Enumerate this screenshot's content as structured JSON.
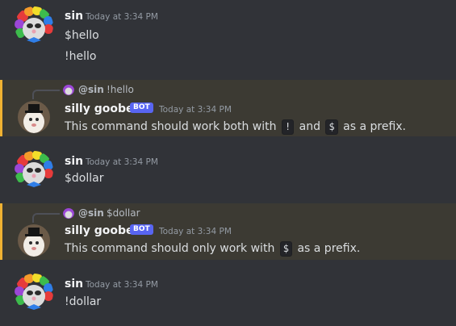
{
  "messages": [
    {
      "author": "sin",
      "timestamp": "Today at 3:34 PM",
      "lines": [
        "$hello",
        "!hello"
      ]
    },
    {
      "reply_to_author": "@sin",
      "reply_to_text": "!hello",
      "author": "silly goober",
      "badge": "BOT",
      "timestamp": "Today at 3:34 PM",
      "text_parts": [
        "This command should work both with",
        "!",
        "and",
        "$",
        "as a prefix."
      ]
    },
    {
      "author": "sin",
      "timestamp": "Today at 3:34 PM",
      "lines": [
        "$dollar"
      ]
    },
    {
      "reply_to_author": "@sin",
      "reply_to_text": "$dollar",
      "author": "silly goober",
      "badge": "BOT",
      "timestamp": "Today at 3:34 PM",
      "text_parts": [
        "This command should only work with",
        "$",
        "as a prefix."
      ]
    },
    {
      "author": "sin",
      "timestamp": "Today at 3:34 PM",
      "lines": [
        "!dollar"
      ]
    }
  ],
  "colors": {
    "background": "#313338",
    "highlight": "#3c3a33",
    "highlight_bar": "#f0b232",
    "bot_badge": "#5865f2"
  },
  "icons": {
    "sin_avatar": "clown-cat-avatar-icon",
    "bot_avatar": "top-hat-cat-avatar-icon"
  }
}
